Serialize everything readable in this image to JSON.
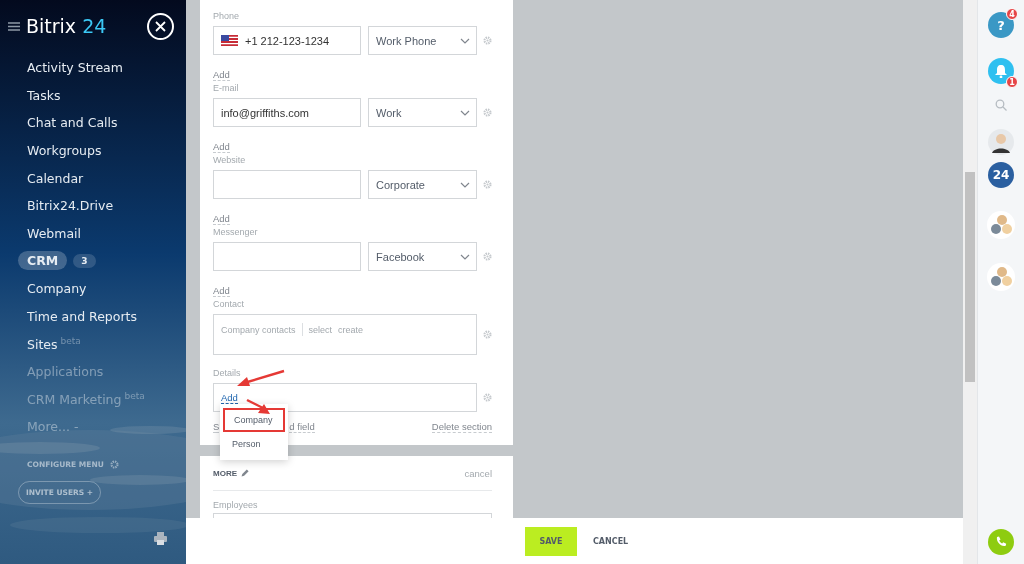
{
  "sidebar": {
    "logo": {
      "name": "Bitrix",
      "number": "24"
    },
    "items": [
      {
        "label": "Activity Stream",
        "selected": false,
        "faded": false
      },
      {
        "label": "Tasks",
        "selected": false,
        "faded": false
      },
      {
        "label": "Chat and Calls",
        "selected": false,
        "faded": false
      },
      {
        "label": "Workgroups",
        "selected": false,
        "faded": false
      },
      {
        "label": "Calendar",
        "selected": false,
        "faded": false
      },
      {
        "label": "Bitrix24.Drive",
        "selected": false,
        "faded": false
      },
      {
        "label": "Webmail",
        "selected": false,
        "faded": false
      },
      {
        "label": "CRM",
        "selected": true,
        "faded": false,
        "counter": "3"
      },
      {
        "label": "Company",
        "selected": false,
        "faded": false
      },
      {
        "label": "Time and Reports",
        "selected": false,
        "faded": false
      },
      {
        "label": "Sites",
        "selected": false,
        "faded": false,
        "sup": "beta"
      },
      {
        "label": "Applications",
        "selected": false,
        "faded": true
      },
      {
        "label": "CRM Marketing",
        "selected": false,
        "faded": true,
        "sup": "beta"
      },
      {
        "label": "More... -",
        "selected": false,
        "faded": true
      }
    ],
    "configure": "CONFIGURE MENU",
    "invite": "INVITE USERS +"
  },
  "form": {
    "fields": [
      {
        "kind": "multi",
        "label": "Phone",
        "value": "+1 212-123-1234",
        "flag": true,
        "type": "Work Phone",
        "add": "Add"
      },
      {
        "kind": "multi",
        "label": "E-mail",
        "value": "info@griffiths.com",
        "flag": false,
        "type": "Work",
        "add": "Add"
      },
      {
        "kind": "multi",
        "label": "Website",
        "flag": false,
        "type": "Corporate",
        "add": "Add"
      },
      {
        "kind": "multi",
        "label": "Messenger",
        "flag": false,
        "type": "Facebook",
        "add": "Add"
      },
      {
        "kind": "contact",
        "label": "Contact",
        "placeholder": "Company contacts",
        "actions": [
          "select",
          "create"
        ]
      },
      {
        "kind": "details",
        "label": "Details",
        "add": "Add"
      }
    ],
    "select_field_parts": [
      "S",
      "d field"
    ],
    "delete_section": "Delete section",
    "dropdown": [
      {
        "label": "Company",
        "highlighted": true
      },
      {
        "label": "Person",
        "highlighted": false
      }
    ]
  },
  "more": {
    "title": "MORE",
    "cancel": "cancel",
    "field": "Employees"
  },
  "footer": {
    "save": "SAVE",
    "cancel": "CANCEL"
  },
  "right_panel": {
    "help_label": "?",
    "help_badge": "4",
    "bell_badge": "1",
    "app_label": "24"
  }
}
